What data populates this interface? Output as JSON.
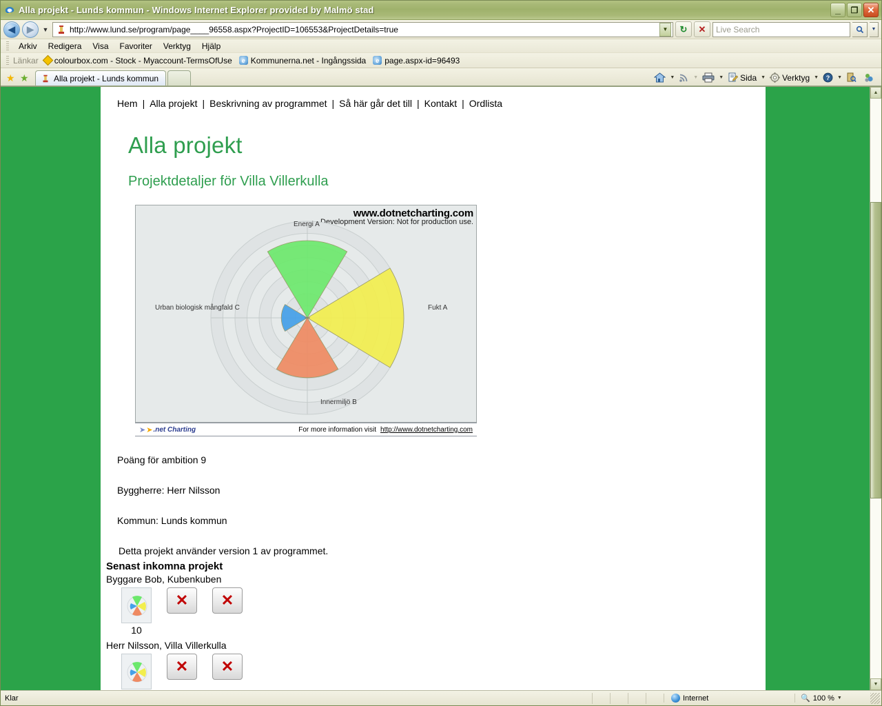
{
  "window": {
    "title": "Alla projekt - Lunds kommun - Windows Internet Explorer provided by Malmö stad",
    "minimize_label": "_",
    "maximize_label": "❐",
    "close_label": "✕"
  },
  "address_bar": {
    "back_label": "◀",
    "forward_label": "▶",
    "history_caret": "▼",
    "url": "http://www.lund.se/program/page____96558.aspx?ProjectID=106553&ProjectDetails=true",
    "url_dropdown_caret": "▼",
    "refresh_label": "↻",
    "stop_label": "✕",
    "search_placeholder": "Live Search",
    "search_value": "",
    "search_go_label": "🔍",
    "search_caret": "▼"
  },
  "menubar": {
    "items": [
      {
        "label": "Arkiv"
      },
      {
        "label": "Redigera"
      },
      {
        "label": "Visa"
      },
      {
        "label": "Favoriter"
      },
      {
        "label": "Verktyg"
      },
      {
        "label": "Hjälp"
      }
    ]
  },
  "linksbar": {
    "label": "Länkar",
    "items": [
      {
        "label": "colourbox.com - Stock - Myaccount-TermsOfUse",
        "icon": "diamond-icon"
      },
      {
        "label": "Kommunerna.net - Ingångssida",
        "icon": "ie-page-icon"
      },
      {
        "label": "page.aspx-id=96493",
        "icon": "ie-page-icon"
      }
    ]
  },
  "tabbar": {
    "favorites_star": "★",
    "add_favorites_star": "★",
    "tabs": [
      {
        "label": "Alla projekt - Lunds kommun",
        "active": true
      }
    ],
    "new_tab_label": "",
    "commands": [
      {
        "label": "",
        "icon": "home-icon",
        "caret": "▼"
      },
      {
        "label": "",
        "icon": "rss-icon",
        "caret": "▼"
      },
      {
        "label": "",
        "icon": "print-icon",
        "caret": "▼"
      },
      {
        "label": "Sida",
        "icon": "page-icon",
        "caret": "▼"
      },
      {
        "label": "Verktyg",
        "icon": "gear-icon",
        "caret": "▼"
      },
      {
        "label": "",
        "icon": "help-icon",
        "caret": "▼"
      },
      {
        "label": "",
        "icon": "research-icon",
        "caret": ""
      },
      {
        "label": "",
        "icon": "messenger-icon",
        "caret": ""
      }
    ]
  },
  "page": {
    "topnav": [
      {
        "label": "Hem"
      },
      {
        "label": "Alla projekt"
      },
      {
        "label": "Beskrivning av programmet"
      },
      {
        "label": "Så här går det till"
      },
      {
        "label": "Kontakt"
      },
      {
        "label": "Ordlista"
      }
    ],
    "nav_separator": "|",
    "title": "Alla projekt",
    "subtitle": "Projektdetaljer för Villa Villerkulla",
    "details": [
      "Poäng för ambition 9",
      "Byggherre: Herr Nilsson",
      "Kommun: Lunds kommun"
    ],
    "version_note": "Detta projekt använder version 1 av programmet.",
    "recent_heading": "Senast inkomna projekt",
    "recent_projects": [
      {
        "name": "Byggare Bob, Kubenkuben",
        "score": "10",
        "delete_label": "✕",
        "remove_label": "✕"
      },
      {
        "name": "Herr Nilsson, Villa Villerkulla",
        "score": "",
        "delete_label": "✕",
        "remove_label": "✕"
      }
    ]
  },
  "chart_data": {
    "type": "pie",
    "title": "",
    "watermark_line1": "www.dotnetcharting.com",
    "watermark_line2": "Development Version: Not for production use.",
    "categories": [
      "Energi A",
      "Fukt A",
      "Innermiljö B",
      "Urban biologisk mångfald C"
    ],
    "values": [
      80,
      100,
      62,
      27
    ],
    "value_max": 100,
    "colors": [
      "#6ce86c",
      "#f2ee4e",
      "#ef8a62",
      "#44a0e8"
    ],
    "angles_deg": [
      90,
      0,
      270,
      180
    ],
    "wedge_span_deg": 62,
    "grid": true,
    "grid_rings": 8,
    "legend_position": "none",
    "xlabel": "",
    "ylabel": "",
    "footer_logo": ".net Charting",
    "footer_text": "For more information visit",
    "footer_link": "http://www.dotnetcharting.com"
  },
  "scrollbar": {
    "up_label": "▲",
    "down_label": "▼"
  },
  "statusbar": {
    "status": "Klar",
    "zone": "Internet",
    "zoom": "100 %",
    "zoom_caret": "▼"
  }
}
